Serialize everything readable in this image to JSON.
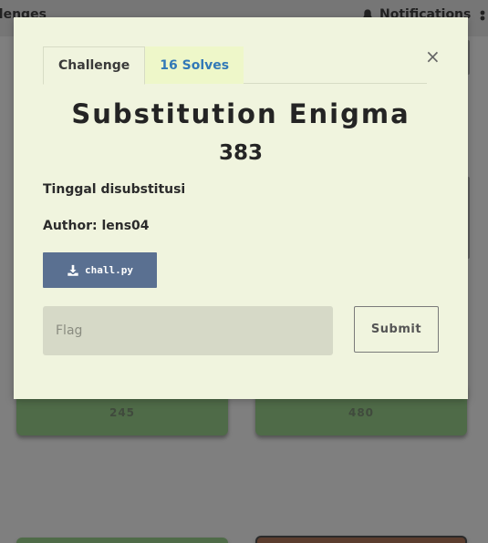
{
  "background": {
    "nav_title_fragment": "llenges",
    "notifications_label": "Notifications",
    "cards": [
      {
        "value": "245"
      },
      {
        "value": "480"
      }
    ]
  },
  "modal": {
    "tabs": [
      {
        "label": "Challenge"
      },
      {
        "label": "16 Solves"
      }
    ],
    "close_label": "×",
    "challenge_name": "Substitution Enigma",
    "points": "383",
    "description": "Tinggal disubstitusi",
    "author": "Author: lens04",
    "file_label": "chall.py",
    "flag_placeholder": "Flag",
    "submit_label": "Submit"
  }
}
